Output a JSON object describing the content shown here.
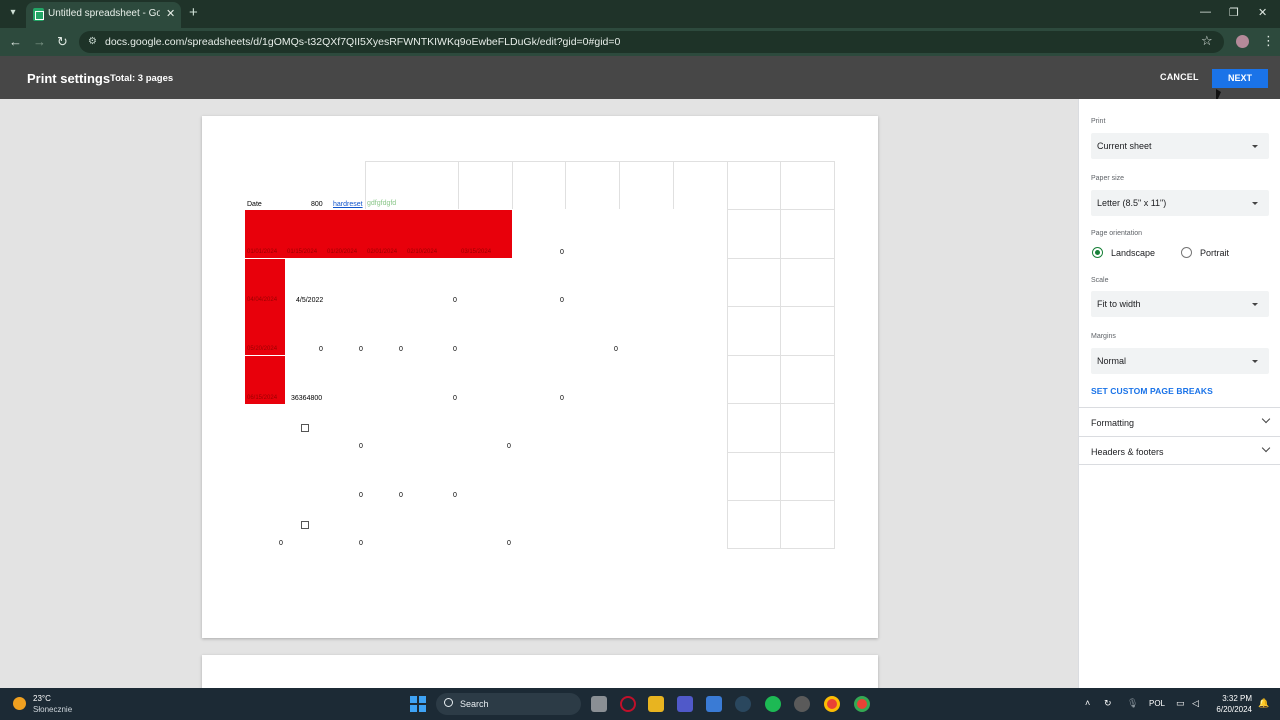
{
  "browser": {
    "tab_title": "Untitled spreadsheet - Google",
    "url": "docs.google.com/spreadsheets/d/1gOMQs-t32QXf7QII5XyesRFWNTKIWKq9oEwbeFLDuGk/edit?gid=0#gid=0"
  },
  "header": {
    "title": "Print settings",
    "total": "Total: 3 pages",
    "cancel": "CANCEL",
    "next": "NEXT"
  },
  "preview": {
    "row1": {
      "date": "Date",
      "value": "800",
      "link": "hardreset",
      "green": "gdfgfdgfd"
    },
    "red_dates": [
      "01/01/2024",
      "01/15/2024",
      "01/20/2024",
      "02/01/2024",
      "02/10/2024",
      "03/15/2024"
    ],
    "col_dates": [
      "04/04/2024",
      "05/20/2024",
      "06/15/2024"
    ],
    "cells": {
      "r2_zero": "0",
      "r3_date": "4/5/2022",
      "r3_zero_a": "0",
      "r3_zero_b": "0",
      "r4_zero_a": "0",
      "r4_zero_b": "0",
      "r4_zero_c": "0",
      "r4_zero_d": "0",
      "r4_zero_e": "0",
      "r5_number": "36364800",
      "r5_zero_a": "0",
      "r5_zero_b": "0",
      "r6_zero_a": "0",
      "r6_zero_b": "0",
      "r7_zero_a": "0",
      "r7_zero_b": "0",
      "r7_zero_c": "0",
      "r8_zero_a": "0",
      "r8_zero_b": "0",
      "r8_zero_c": "0"
    }
  },
  "sidebar": {
    "print_label": "Print",
    "print_value": "Current sheet",
    "paper_label": "Paper size",
    "paper_value": "Letter (8.5\" x 11\")",
    "orientation_label": "Page orientation",
    "landscape": "Landscape",
    "portrait": "Portrait",
    "scale_label": "Scale",
    "scale_value": "Fit to width",
    "margins_label": "Margins",
    "margins_value": "Normal",
    "page_breaks": "SET CUSTOM PAGE BREAKS",
    "formatting": "Formatting",
    "headers_footers": "Headers & footers"
  },
  "taskbar": {
    "temp": "23°C",
    "condition": "Słonecznie",
    "search": "Search",
    "lang": "POL",
    "time": "3:32 PM",
    "date": "6/20/2024"
  },
  "colors": {
    "accent": "#1a73e8",
    "red_cell": "#e8000b",
    "header_bg": "#474747"
  },
  "icons": [
    "tab-menu-icon",
    "sheets-icon",
    "close-icon",
    "plus-icon",
    "minimize-icon",
    "maximize-icon",
    "back-icon",
    "forward-icon",
    "reload-icon",
    "site-info-icon",
    "star-icon",
    "profile-icon",
    "more-icon",
    "chevron-down-icon",
    "windows-icon",
    "search-icon"
  ]
}
